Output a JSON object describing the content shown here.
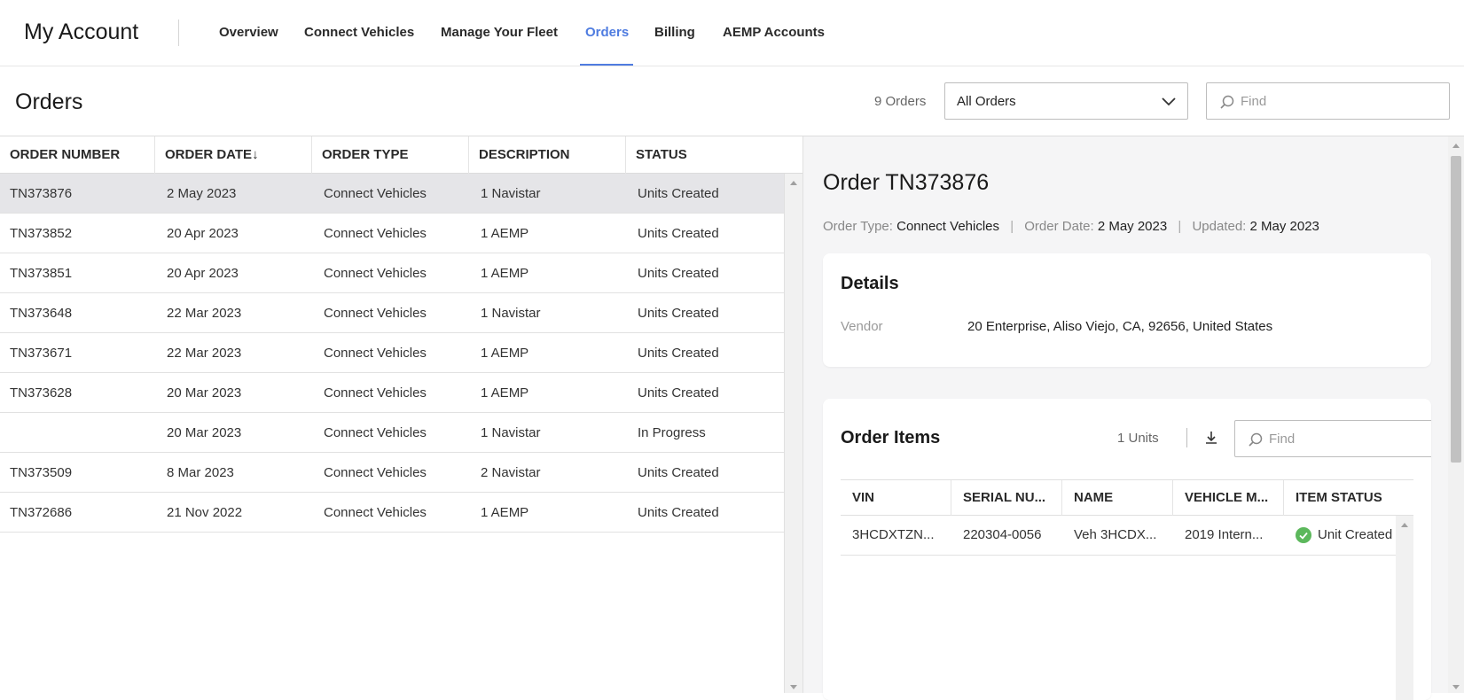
{
  "header": {
    "brand": "My Account",
    "nav": [
      "Overview",
      "Connect Vehicles",
      "Manage Your Fleet",
      "Orders",
      "Billing",
      "AEMP Accounts"
    ],
    "active_nav": "Orders"
  },
  "orders_bar": {
    "title": "Orders",
    "count": "9 Orders",
    "filter_value": "All Orders",
    "find_placeholder": "Find"
  },
  "orders_table": {
    "columns": [
      "ORDER NUMBER",
      "ORDER DATE",
      "ORDER TYPE",
      "DESCRIPTION",
      "STATUS"
    ],
    "sort_glyph": "↓",
    "rows": [
      {
        "number": "TN373876",
        "date": "2 May 2023",
        "type": "Connect Vehicles",
        "description": "1 Navistar",
        "status": "Units Created"
      },
      {
        "number": "TN373852",
        "date": "20 Apr 2023",
        "type": "Connect Vehicles",
        "description": "1 AEMP",
        "status": "Units Created"
      },
      {
        "number": "TN373851",
        "date": "20 Apr 2023",
        "type": "Connect Vehicles",
        "description": "1 AEMP",
        "status": "Units Created"
      },
      {
        "number": "TN373648",
        "date": "22 Mar 2023",
        "type": "Connect Vehicles",
        "description": "1 Navistar",
        "status": "Units Created"
      },
      {
        "number": "TN373671",
        "date": "22 Mar 2023",
        "type": "Connect Vehicles",
        "description": "1 AEMP",
        "status": "Units Created"
      },
      {
        "number": "TN373628",
        "date": "20 Mar 2023",
        "type": "Connect Vehicles",
        "description": "1 AEMP",
        "status": "Units Created"
      },
      {
        "number": "",
        "date": "20 Mar 2023",
        "type": "Connect Vehicles",
        "description": "1 Navistar",
        "status": "In Progress"
      },
      {
        "number": "TN373509",
        "date": "8 Mar 2023",
        "type": "Connect Vehicles",
        "description": "2 Navistar",
        "status": "Units Created"
      },
      {
        "number": "TN372686",
        "date": "21 Nov 2022",
        "type": "Connect Vehicles",
        "description": "1 AEMP",
        "status": "Units Created"
      }
    ]
  },
  "order_detail": {
    "heading": "Order TN373876",
    "meta": {
      "type_label": "Order Type:",
      "type_value": "Connect Vehicles",
      "date_label": "Order Date:",
      "date_value": "2 May 2023",
      "updated_label": "Updated:",
      "updated_value": "2 May 2023",
      "separator": "|"
    },
    "details": {
      "title": "Details",
      "vendor_label": "Vendor",
      "vendor_value": "20 Enterprise, Aliso Viejo, CA, 92656, United States"
    },
    "items": {
      "title": "Order Items",
      "units": "1 Units",
      "find_placeholder": "Find",
      "columns": [
        "VIN",
        "SERIAL NU...",
        "NAME",
        "VEHICLE M...",
        "ITEM STATUS"
      ],
      "rows": [
        {
          "vin": "3HCDXTZN...",
          "serial": "220304-0056",
          "name": "Veh 3HCDX...",
          "vehicle": "2019 Intern...",
          "status": "Unit Created"
        }
      ]
    }
  },
  "colors": {
    "accent": "#4f7ce0",
    "success": "#5cb85c",
    "selected_row": "#e5e5e8"
  },
  "icons": [
    "chevron-down-icon",
    "search-icon",
    "download-icon",
    "check-circle-icon"
  ]
}
